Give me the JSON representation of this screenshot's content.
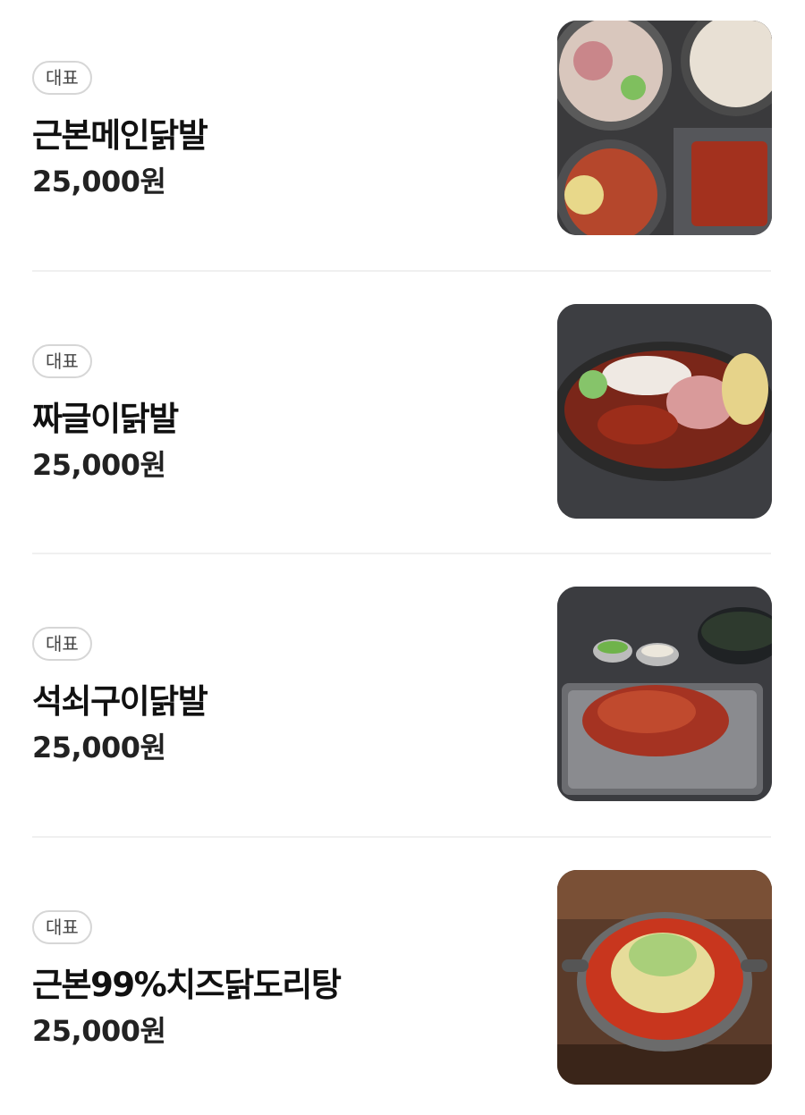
{
  "menu": {
    "items": [
      {
        "badge": "대표",
        "name": "근본메인닭발",
        "price": "25,000원",
        "image_alt": "근본메인닭발 photo"
      },
      {
        "badge": "대표",
        "name": "짜글이닭발",
        "price": "25,000원",
        "image_alt": "짜글이닭발 photo"
      },
      {
        "badge": "대표",
        "name": "석쇠구이닭발",
        "price": "25,000원",
        "image_alt": "석쇠구이닭발 photo"
      },
      {
        "badge": "대표",
        "name": "근본99%치즈닭도리탕",
        "price": "25,000원",
        "image_alt": "근본99%치즈닭도리탕 photo"
      }
    ]
  }
}
